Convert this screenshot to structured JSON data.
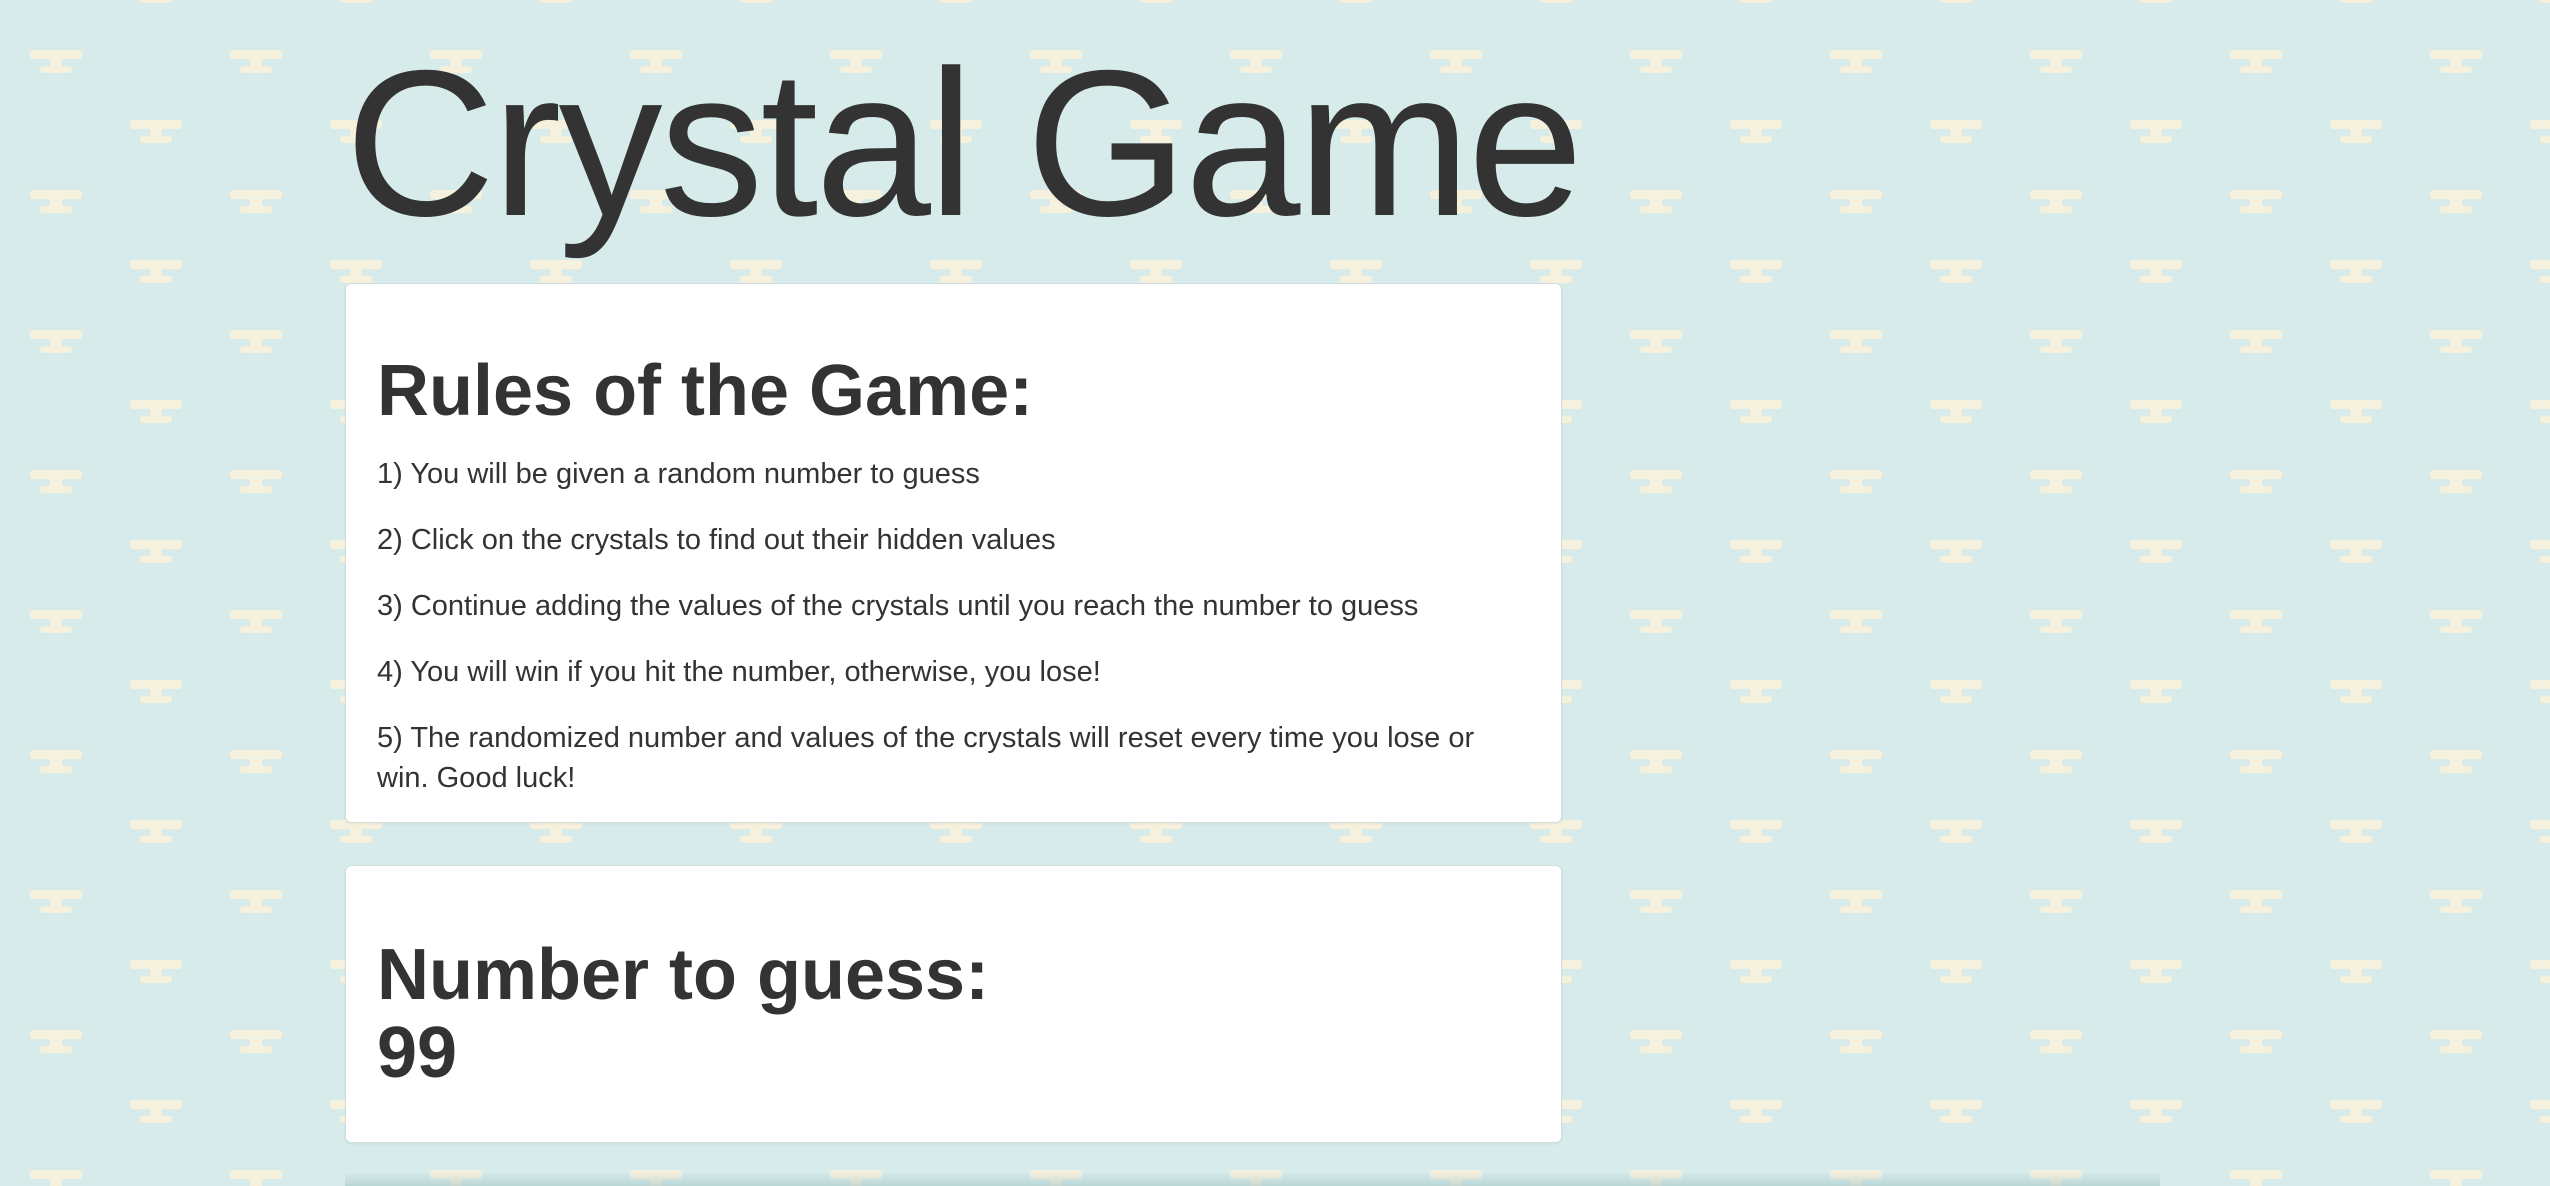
{
  "page": {
    "title": "Crystal Game",
    "background_color": "#d6ebea",
    "pattern_color": "#f6f1dc"
  },
  "rules": {
    "heading": "Rules of the Game:",
    "items": [
      "1) You will be given a random number to guess",
      "2) Click on the crystals to find out their hidden values",
      "3) Continue adding the values of the crystals until you reach the number to guess",
      "4) You will win if you hit the number, otherwise, you lose!",
      "5) The randomized number and values of the crystals will reset every time you lose or win. Good luck!"
    ]
  },
  "guess": {
    "heading": "Number to guess:",
    "value": "99"
  }
}
